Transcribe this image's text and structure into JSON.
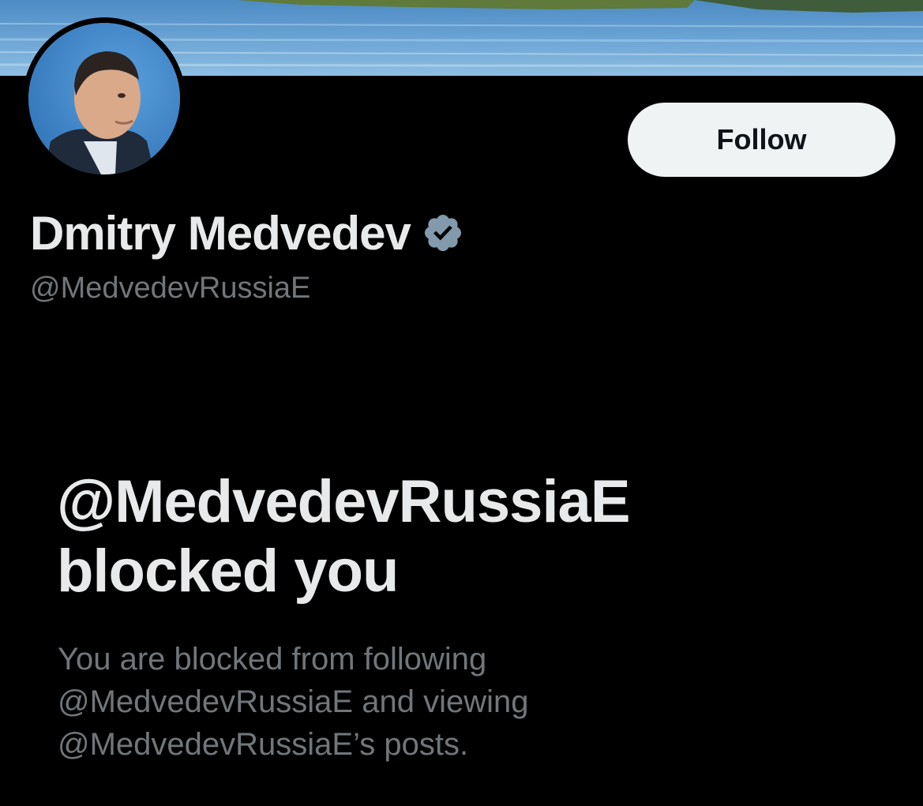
{
  "header": {
    "banner_icon": "lake-landscape-banner",
    "avatar_icon": "profile-photo"
  },
  "profile": {
    "follow_label": "Follow",
    "display_name": "Dmitry Medvedev",
    "verified_icon": "verified-badge-icon",
    "handle": "@MedvedevRussiaE"
  },
  "blocked": {
    "title_line1": "@MedvedevRussiaE",
    "title_line2": "blocked you",
    "desc_line1": "You are blocked from following",
    "desc_line2": "@MedvedevRussiaE and viewing",
    "desc_line3": "@MedvedevRussiaE’s posts."
  },
  "colors": {
    "background": "#000000",
    "primary_text": "#e7e9ea",
    "secondary_text": "#71767b",
    "follow_button_bg": "#eff3f4",
    "follow_button_text": "#0f1419",
    "verified_badge": "#829aab"
  }
}
